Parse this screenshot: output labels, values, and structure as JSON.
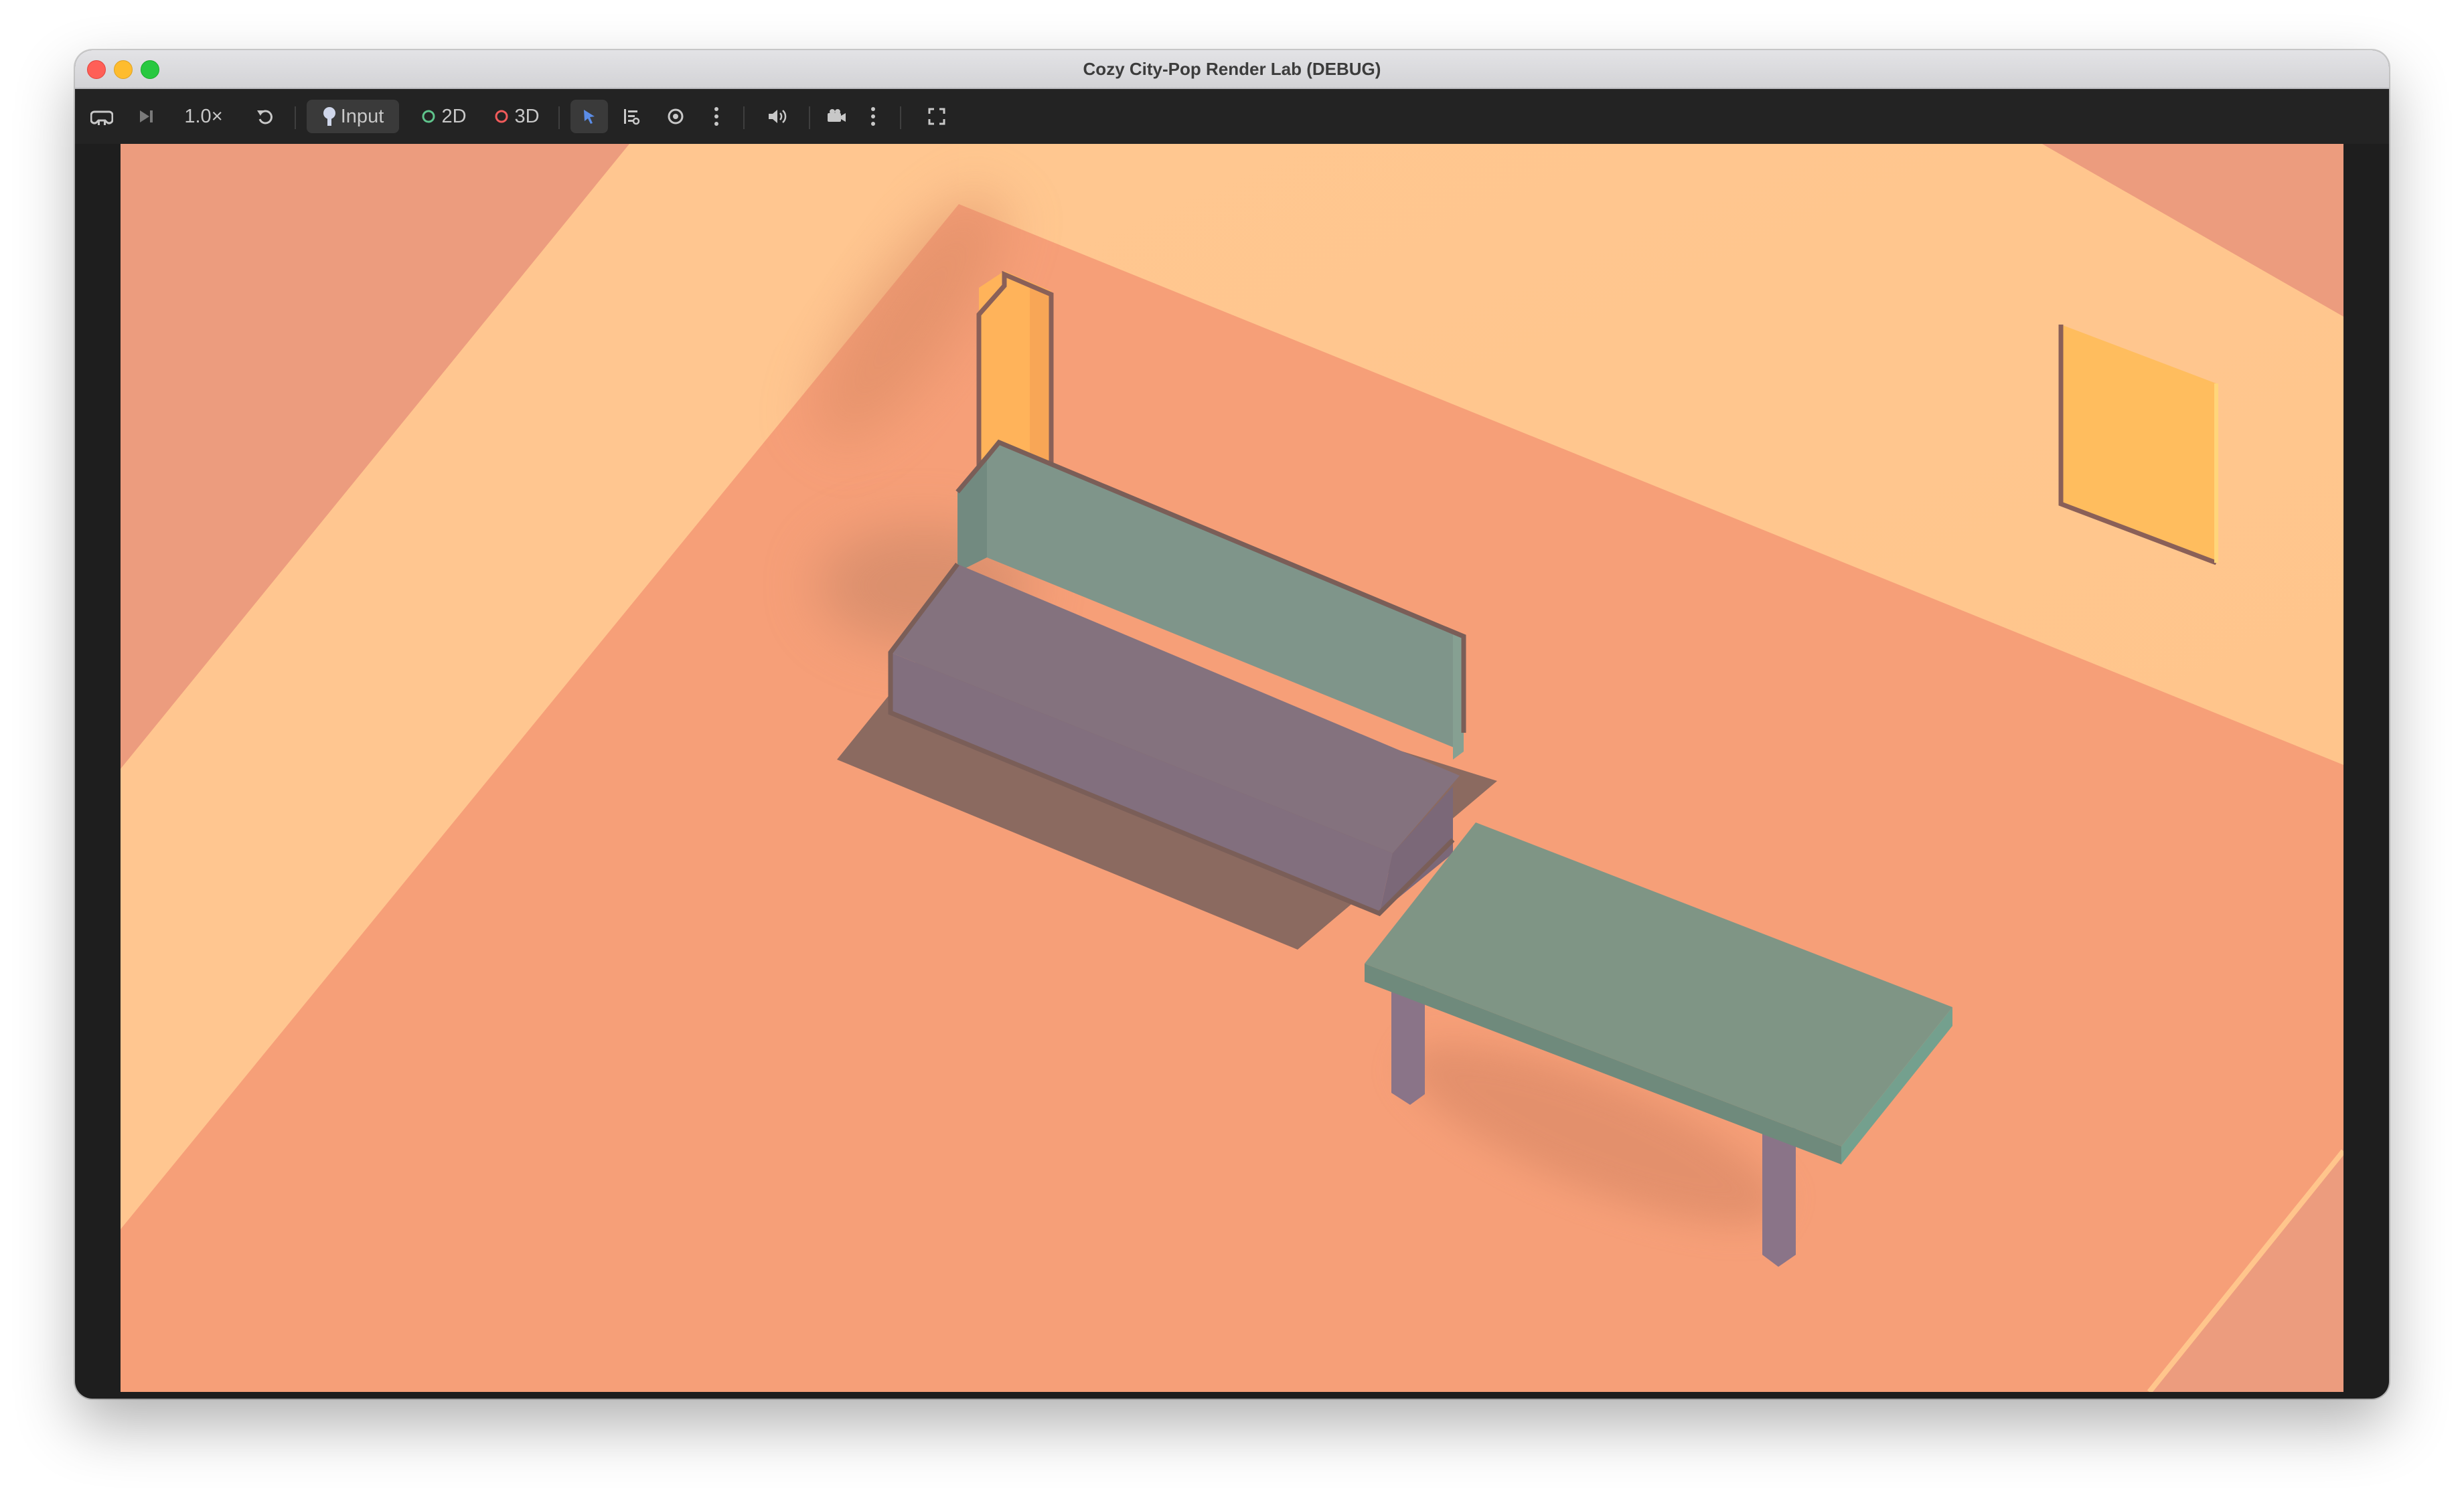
{
  "window": {
    "title": "Cozy City-Pop Render Lab (DEBUG)"
  },
  "toolbar": {
    "speed": "1.0×",
    "input_label": "Input",
    "mode_2d": "2D",
    "mode_3d": "3D"
  },
  "icons": {
    "app": "game-controller-icon",
    "step": "step-forward-icon",
    "reset": "reset-icon",
    "input": "input-icon",
    "select": "select-arrow-icon",
    "list": "list-icon",
    "visibility": "eye-icon",
    "more": "more-vertical-icon",
    "audio": "speaker-icon",
    "camera": "camera-icon",
    "fullscreen": "fullscreen-icon"
  },
  "colors": {
    "floor": "#f69f78",
    "wall": "#ffc58e",
    "sofa_back": "#7f958a",
    "sofa_seat": "#84727e",
    "table_top": "#7f9585",
    "window_glow": "#ffbd5e",
    "mode_2d_ring": "#5fc48c",
    "mode_3d_ring": "#f15b5b"
  }
}
